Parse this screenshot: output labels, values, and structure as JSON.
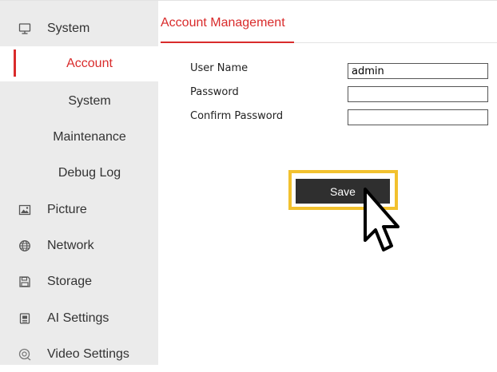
{
  "sidebar": {
    "items": [
      {
        "label": "System",
        "icon": "monitor-icon"
      },
      {
        "label": "Picture",
        "icon": "picture-icon"
      },
      {
        "label": "Network",
        "icon": "globe-icon"
      },
      {
        "label": "Storage",
        "icon": "floppy-disk-icon"
      },
      {
        "label": "AI Settings",
        "icon": "ai-chip-icon"
      },
      {
        "label": "Video Settings",
        "icon": "video-camera-icon"
      }
    ],
    "subitems": [
      {
        "label": "Account",
        "active": true
      },
      {
        "label": "System",
        "active": false
      },
      {
        "label": "Maintenance",
        "active": false
      },
      {
        "label": "Debug Log",
        "active": false
      }
    ]
  },
  "main": {
    "title": "Account Management",
    "form": {
      "username_label": "User Name",
      "username_value": "admin",
      "password_label": "Password",
      "password_value": "",
      "confirm_label": "Confirm Password",
      "confirm_value": ""
    },
    "save_label": "Save"
  },
  "colors": {
    "accent": "#d92b2b",
    "sidebar_bg": "#ebebeb",
    "button_bg": "#2f2f2f",
    "highlight": "#f2c12e"
  }
}
